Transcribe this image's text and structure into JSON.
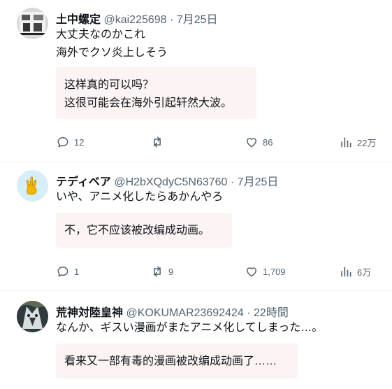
{
  "posts": [
    {
      "name": "土中螺定",
      "handle": "@kai225698",
      "separator": "·",
      "time": "7月25日",
      "lines": [
        "大丈夫なのかこれ",
        "海外でクソ炎上しそう"
      ],
      "translation": [
        "这样真的可以吗？",
        "这很可能会在海外引起轩然大波。"
      ],
      "replies": "12",
      "retweets": "",
      "likes": "86",
      "views": "22万"
    },
    {
      "name": "テディベア",
      "handle": "@H2bXQdyC5N63760",
      "separator": "·",
      "time": "7月25日",
      "lines": [
        "いや、アニメ化したらあかんやろ"
      ],
      "translation": [
        "不，它不应该被改编成动画。"
      ],
      "replies": "1",
      "retweets": "9",
      "likes": "1,709",
      "views": "6万"
    },
    {
      "name": "荒神対陸皇神",
      "handle": "@KOKUMAR23692424",
      "separator": "·",
      "time": "22時間",
      "lines": [
        "なんか、ギスい漫画がまたアニメ化してしまった…。"
      ],
      "translation": [
        "看来又一部有毒的漫画被改编成动画了……"
      ]
    }
  ],
  "icons": {
    "reply": "reply-icon",
    "retweet": "retweet-icon",
    "like": "heart-icon",
    "views": "views-icon"
  },
  "colors": {
    "translation_bg": "#fbf4f2",
    "muted_text": "#536471"
  }
}
